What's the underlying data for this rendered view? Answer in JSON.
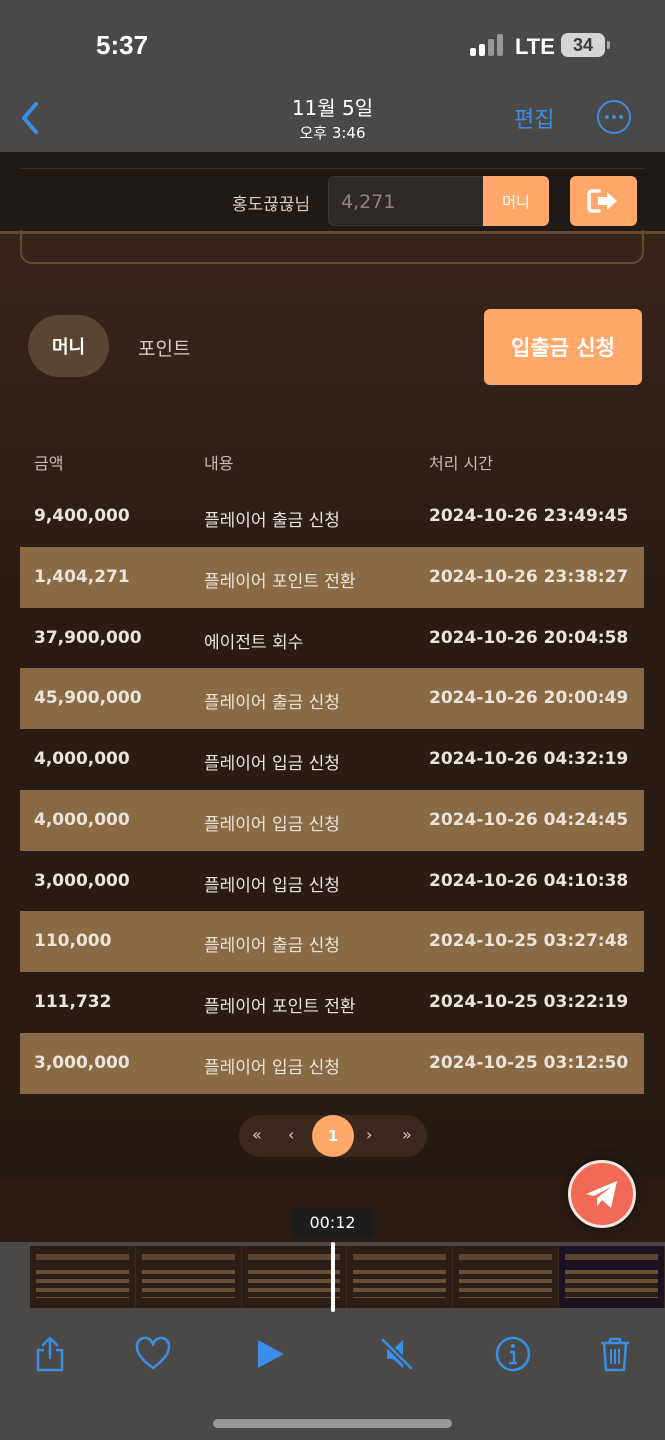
{
  "status_bar": {
    "time": "5:37",
    "network": "LTE",
    "battery": "34"
  },
  "nav": {
    "date": "11월 5일",
    "time": "오후 3:46",
    "edit_label": "편집"
  },
  "header": {
    "username": "홍도끊끊님",
    "balance": "4,271",
    "money_button": "머니"
  },
  "tabs": {
    "money": "머니",
    "point": "포인트"
  },
  "deposit_button": "입출금 신청",
  "table": {
    "headers": [
      "금액",
      "내용",
      "처리 시간"
    ],
    "rows": [
      [
        "9,400,000",
        "플레이어 출금 신청",
        "2024-10-26 23:49:45"
      ],
      [
        "1,404,271",
        "플레이어 포인트 전환",
        "2024-10-26 23:38:27"
      ],
      [
        "37,900,000",
        "에이전트 회수",
        "2024-10-26 20:04:58"
      ],
      [
        "45,900,000",
        "플레이어 출금 신청",
        "2024-10-26 20:00:49"
      ],
      [
        "4,000,000",
        "플레이어 입금 신청",
        "2024-10-26 04:32:19"
      ],
      [
        "4,000,000",
        "플레이어 입금 신청",
        "2024-10-26 04:24:45"
      ],
      [
        "3,000,000",
        "플레이어 입금 신청",
        "2024-10-26 04:10:38"
      ],
      [
        "110,000",
        "플레이어 출금 신청",
        "2024-10-25 03:27:48"
      ],
      [
        "111,732",
        "플레이어 포인트 전환",
        "2024-10-25 03:22:19"
      ],
      [
        "3,000,000",
        "플레이어 입금 신청",
        "2024-10-25 03:12:50"
      ]
    ]
  },
  "pagination": {
    "first": "«",
    "prev": "‹",
    "current": "1",
    "next": "›",
    "last": "»"
  },
  "video": {
    "timer": "00:12"
  },
  "colors": {
    "accent": "#ffa86a",
    "row_alt": "#8a6a44",
    "ios_blue": "#3a8ee6",
    "telegram": "#f06a55"
  },
  "icons": [
    "back-chevron-icon",
    "more-icon",
    "logout-icon",
    "telegram-icon",
    "share-icon",
    "heart-icon",
    "play-icon",
    "mute-icon",
    "info-icon",
    "trash-icon"
  ]
}
